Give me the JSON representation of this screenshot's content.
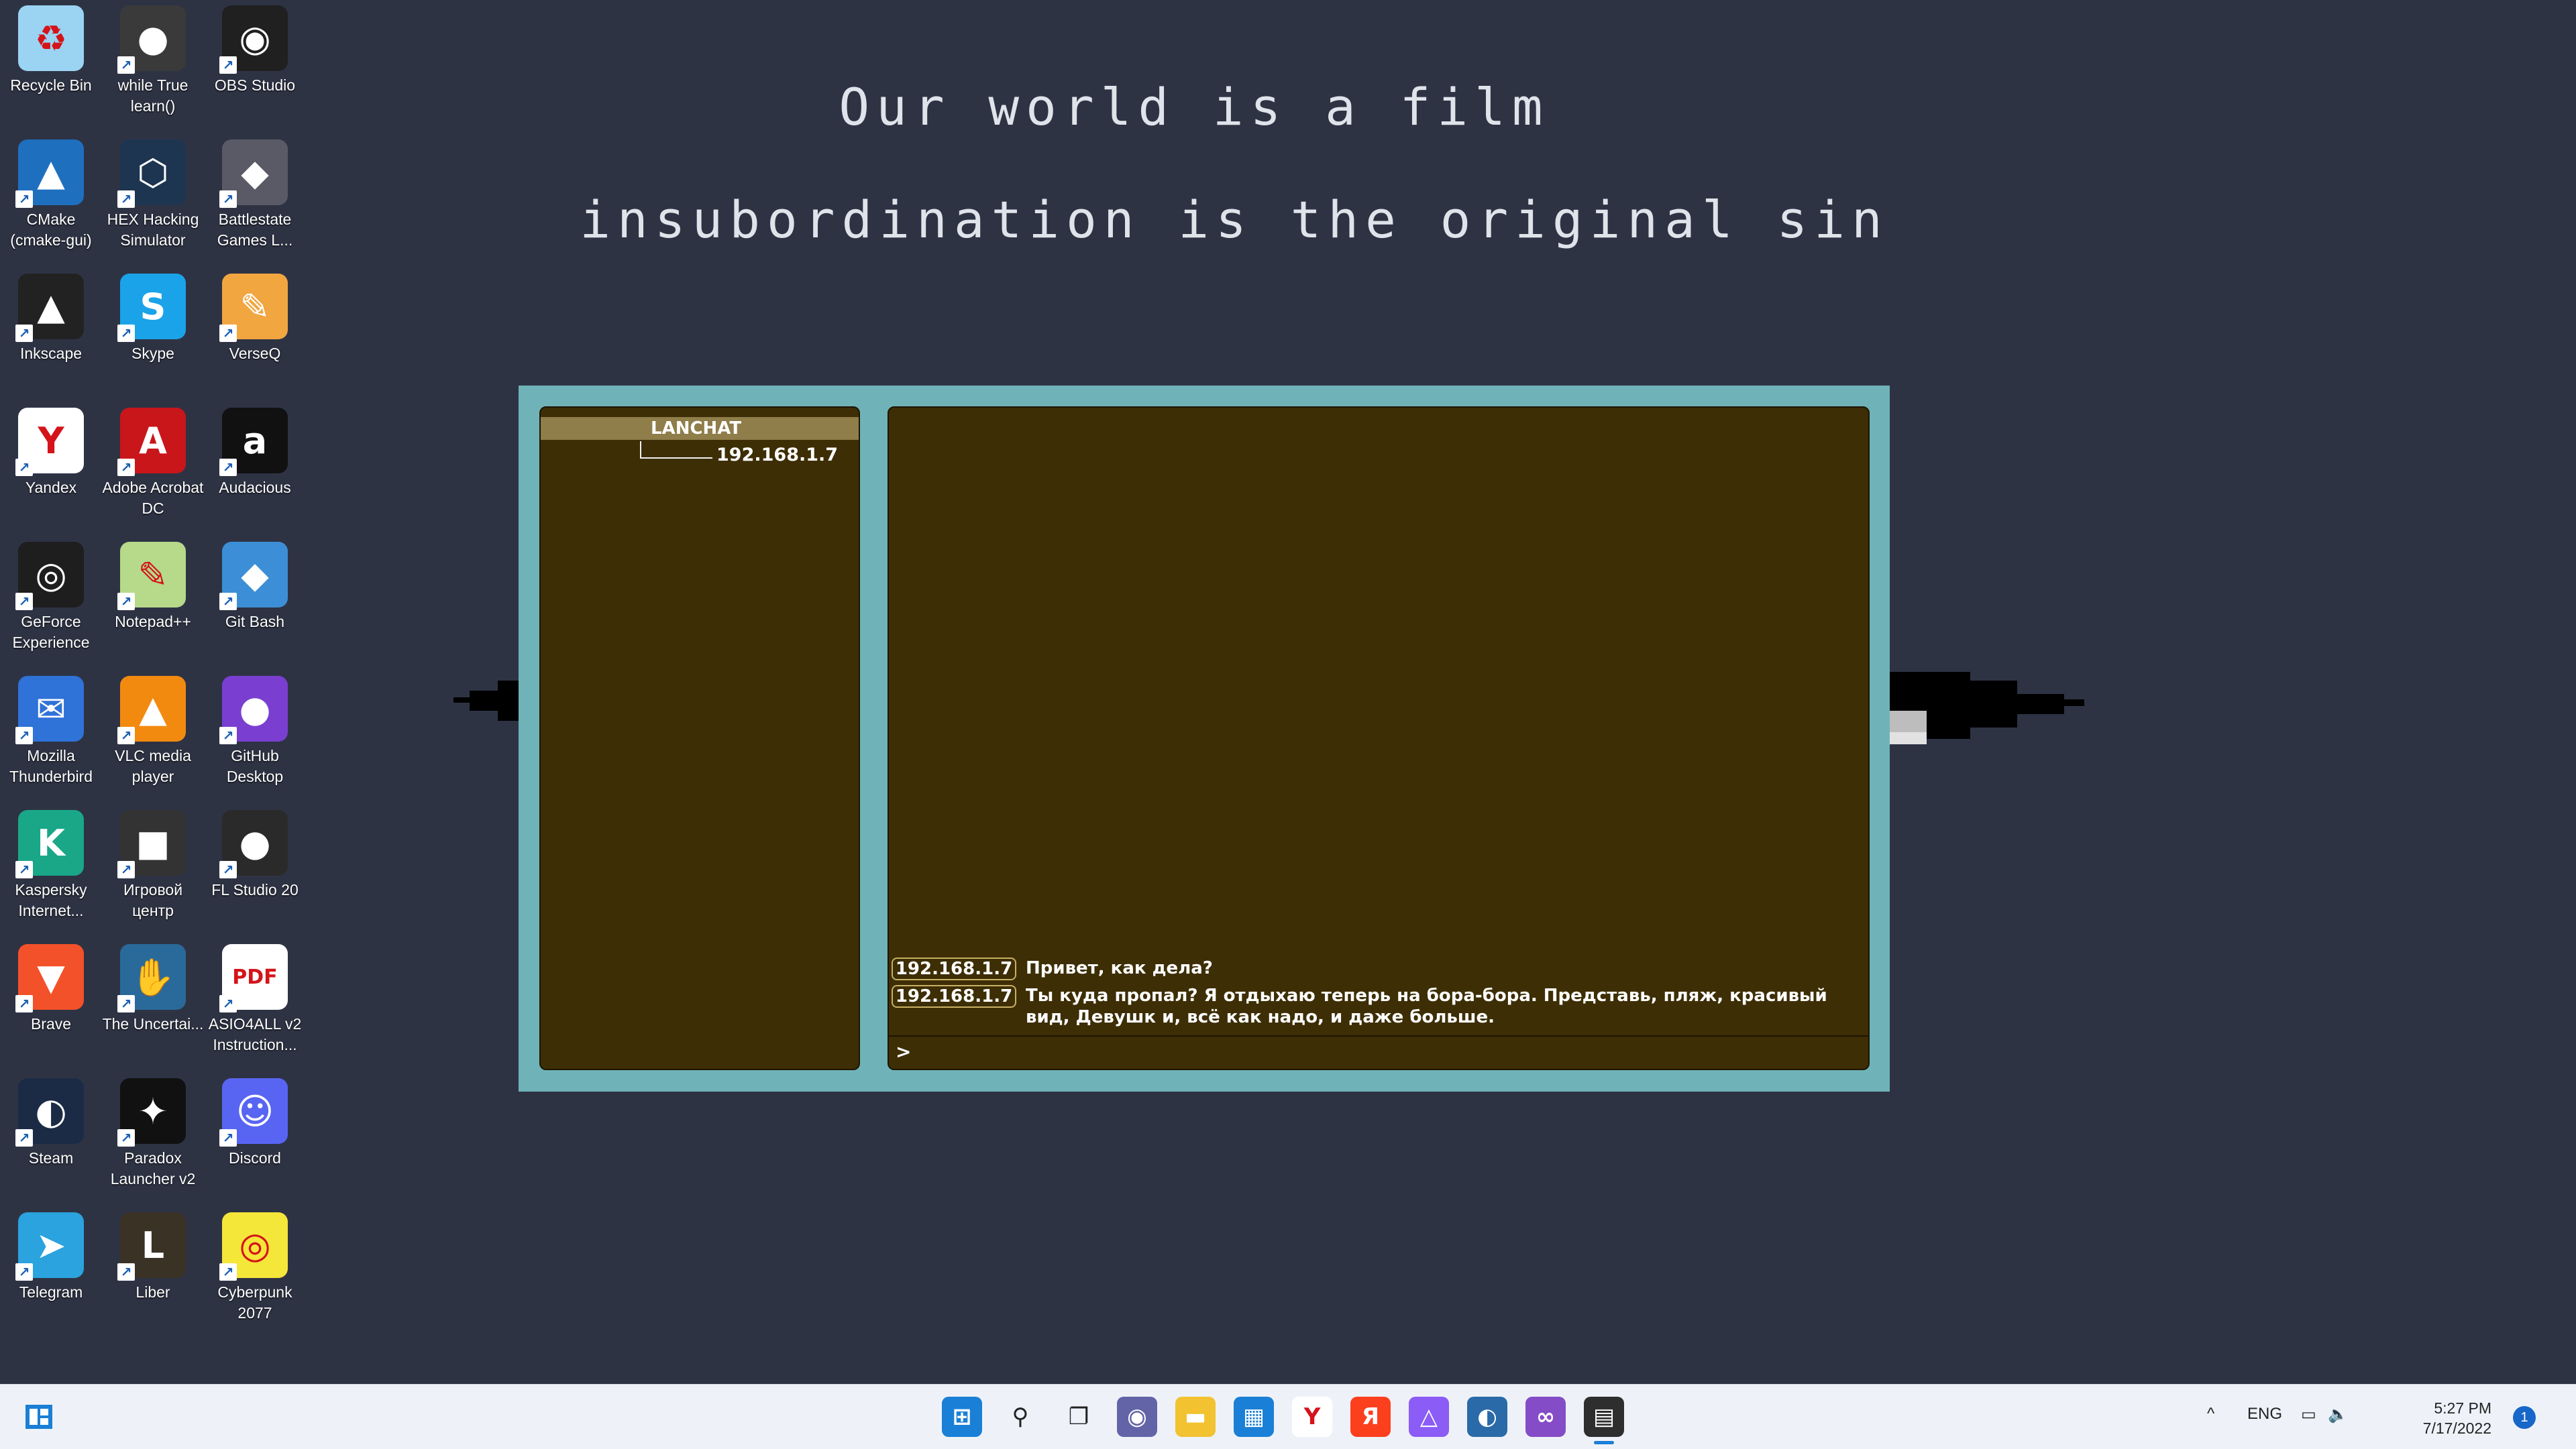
{
  "desktop": {
    "icons": [
      {
        "label": "Recycle Bin",
        "icon": "recycle-bin-icon",
        "color": "#9ad4f2",
        "glyph": "♻"
      },
      {
        "label": "while True learn()",
        "icon": "while-true-learn-icon",
        "color": "#3a3a3a",
        "glyph": "●"
      },
      {
        "label": "OBS Studio",
        "icon": "obs-studio-icon",
        "color": "#202020",
        "glyph": "◉"
      },
      {
        "label": "CMake (cmake-gui)",
        "icon": "cmake-icon",
        "color": "#1f6fbf",
        "glyph": "▲"
      },
      {
        "label": "HEX Hacking Simulator",
        "icon": "hex-hacking-icon",
        "color": "#1d3550",
        "glyph": "⬡"
      },
      {
        "label": "Battlestate Games L...",
        "icon": "battlestate-icon",
        "color": "#5a5a66",
        "glyph": "◆"
      },
      {
        "label": "Inkscape",
        "icon": "inkscape-icon",
        "color": "#222222",
        "glyph": "▲"
      },
      {
        "label": "Skype",
        "icon": "skype-icon",
        "color": "#1aa3e8",
        "glyph": "S"
      },
      {
        "label": "VerseQ",
        "icon": "verseq-icon",
        "color": "#f2a640",
        "glyph": "✎"
      },
      {
        "label": "Yandex",
        "icon": "yandex-browser-icon",
        "color": "#ffffff",
        "glyph": "Y"
      },
      {
        "label": "Adobe Acrobat DC",
        "icon": "adobe-acrobat-icon",
        "color": "#c9161a",
        "glyph": "A"
      },
      {
        "label": "Audacious",
        "icon": "audacious-icon",
        "color": "#111111",
        "glyph": "a"
      },
      {
        "label": "GeForce Experience",
        "icon": "geforce-icon",
        "color": "#1e1e1e",
        "glyph": "◎"
      },
      {
        "label": "Notepad++",
        "icon": "notepad-plus-plus-icon",
        "color": "#b6d98a",
        "glyph": "✎"
      },
      {
        "label": "Git Bash",
        "icon": "git-bash-icon",
        "color": "#3c8fd6",
        "glyph": "◆"
      },
      {
        "label": "Mozilla Thunderbird",
        "icon": "thunderbird-icon",
        "color": "#2f72d8",
        "glyph": "✉"
      },
      {
        "label": "VLC media player",
        "icon": "vlc-icon",
        "color": "#f28a10",
        "glyph": "▲"
      },
      {
        "label": "GitHub Desktop",
        "icon": "github-desktop-icon",
        "color": "#7a3fd1",
        "glyph": "●"
      },
      {
        "label": "Kaspersky Internet...",
        "icon": "kaspersky-icon",
        "color": "#19a788",
        "glyph": "K"
      },
      {
        "label": "Игровой центр",
        "icon": "game-center-icon",
        "color": "#333333",
        "glyph": "■"
      },
      {
        "label": "FL Studio 20",
        "icon": "fl-studio-icon",
        "color": "#2a2a2a",
        "glyph": "●"
      },
      {
        "label": "Brave",
        "icon": "brave-icon",
        "color": "#f3512a",
        "glyph": "▼"
      },
      {
        "label": "The Uncertai...",
        "icon": "the-uncertain-icon",
        "color": "#2a6a9a",
        "glyph": "✋"
      },
      {
        "label": "ASIO4ALL v2 Instruction...",
        "icon": "pdf-file-icon",
        "color": "#ffffff",
        "glyph": "PDF"
      },
      {
        "label": "Steam",
        "icon": "steam-icon",
        "color": "#1b2b45",
        "glyph": "◐"
      },
      {
        "label": "Paradox Launcher v2",
        "icon": "paradox-launcher-icon",
        "color": "#111111",
        "glyph": "✦"
      },
      {
        "label": "Discord",
        "icon": "discord-icon",
        "color": "#5865f2",
        "glyph": "☺"
      },
      {
        "label": "Telegram",
        "icon": "telegram-icon",
        "color": "#2aa3de",
        "glyph": "➤"
      },
      {
        "label": "Liber",
        "icon": "liber-icon",
        "color": "#3b3226",
        "glyph": "L"
      },
      {
        "label": "Cyberpunk 2077",
        "icon": "cyberpunk-icon",
        "color": "#f5e63a",
        "glyph": "◎"
      }
    ]
  },
  "wallpaper": {
    "line1": "Our world is a film",
    "line2": "insubordination is the original sin"
  },
  "chat": {
    "sidebar_title": "LANCHAT",
    "peer": "192.168.1.7",
    "messages": [
      {
        "sender": "192.168.1.7",
        "text": "Привет, как дела?"
      },
      {
        "sender": "192.168.1.7",
        "text": "Ты куда пропал? Я отдыхаю теперь на бора-бора. Представь, пляж, красивый вид, Девушк и, всё как надо, и даже больше."
      }
    ],
    "prompt": ">",
    "colors": {
      "frame": "#6fb3b8",
      "panel": "#3d2e05",
      "header": "#8f7d4a",
      "tag_border": "#c8b067"
    }
  },
  "taskbar": {
    "apps": [
      {
        "icon": "start-icon",
        "color": "#1a7fd6",
        "glyph": "⊞"
      },
      {
        "icon": "search-icon",
        "color": "#eef2f8",
        "glyph": "⚲"
      },
      {
        "icon": "task-view-icon",
        "color": "#eef2f8",
        "glyph": "❐"
      },
      {
        "icon": "teams-chat-icon",
        "color": "#6264a7",
        "glyph": "◉"
      },
      {
        "icon": "file-explorer-icon",
        "color": "#f2c230",
        "glyph": "▬"
      },
      {
        "icon": "microsoft-store-icon",
        "color": "#1a7fd6",
        "glyph": "▦"
      },
      {
        "icon": "yandex-browser-icon",
        "color": "#ffffff",
        "glyph": "Y"
      },
      {
        "icon": "yandex-icon",
        "color": "#fc3f1d",
        "glyph": "Я"
      },
      {
        "icon": "alice-icon",
        "color": "#8b5cf6",
        "glyph": "△"
      },
      {
        "icon": "steam-taskbar-icon",
        "color": "#2a6aa8",
        "glyph": "◐"
      },
      {
        "icon": "visual-studio-icon",
        "color": "#854cc7",
        "glyph": "∞"
      },
      {
        "icon": "lanchat-app-icon",
        "color": "#2e2e2e",
        "glyph": "▤"
      }
    ],
    "tray": {
      "chevron": "^",
      "language": "ENG",
      "time": "5:27 PM",
      "date": "7/17/2022",
      "notifications": "1"
    }
  }
}
